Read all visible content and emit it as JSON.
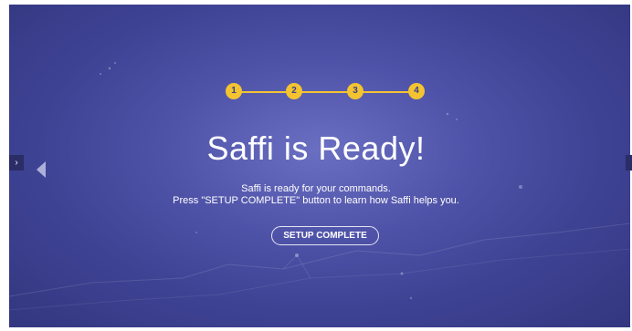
{
  "stepper": {
    "steps": [
      "1",
      "2",
      "3",
      "4"
    ],
    "color": "#f4c430"
  },
  "main": {
    "title": "Saffi is Ready!",
    "subtitle_line1": "Saffi is ready for your commands.",
    "subtitle_line2": "Press \"SETUP COMPLETE\" button to learn how Saffi helps you.",
    "button_label": "SETUP COMPLETE"
  },
  "nav": {
    "side_tab_label": "›"
  },
  "colors": {
    "background": "#4f53a8",
    "accent": "#f4c430",
    "text": "#ffffff"
  }
}
